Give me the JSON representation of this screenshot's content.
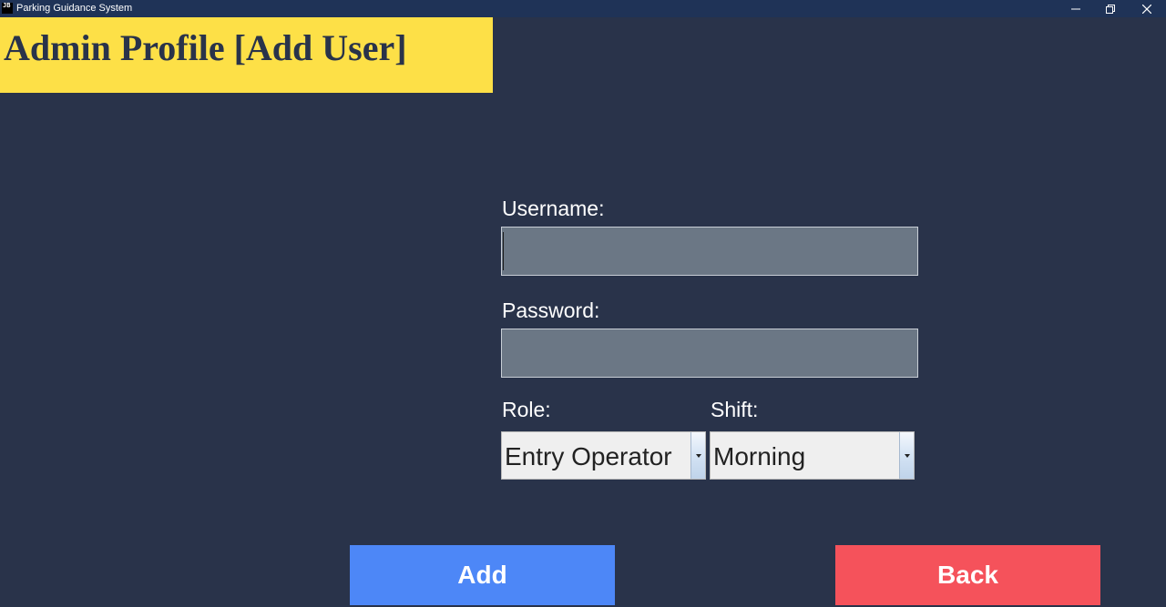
{
  "window": {
    "title": "Parking Guidance System",
    "icon_text": "JB",
    "controls": {
      "minimize": "minimize-icon",
      "restore": "restore-icon",
      "close": "close-icon"
    }
  },
  "header": {
    "title": "Admin Profile [Add User]"
  },
  "form": {
    "username_label": "Username:",
    "username_value": "",
    "password_label": "Password:",
    "password_value": "",
    "role_label": "Role:",
    "role_value": "Entry Operator",
    "shift_label": "Shift:",
    "shift_value": "Morning"
  },
  "actions": {
    "add_label": "Add",
    "back_label": "Back"
  },
  "colors": {
    "background": "#29334a",
    "titlebar": "#1f3357",
    "header_banner": "#fde047",
    "input_fill": "#6b7785",
    "add_button": "#4d87f7",
    "back_button": "#f5525b"
  }
}
